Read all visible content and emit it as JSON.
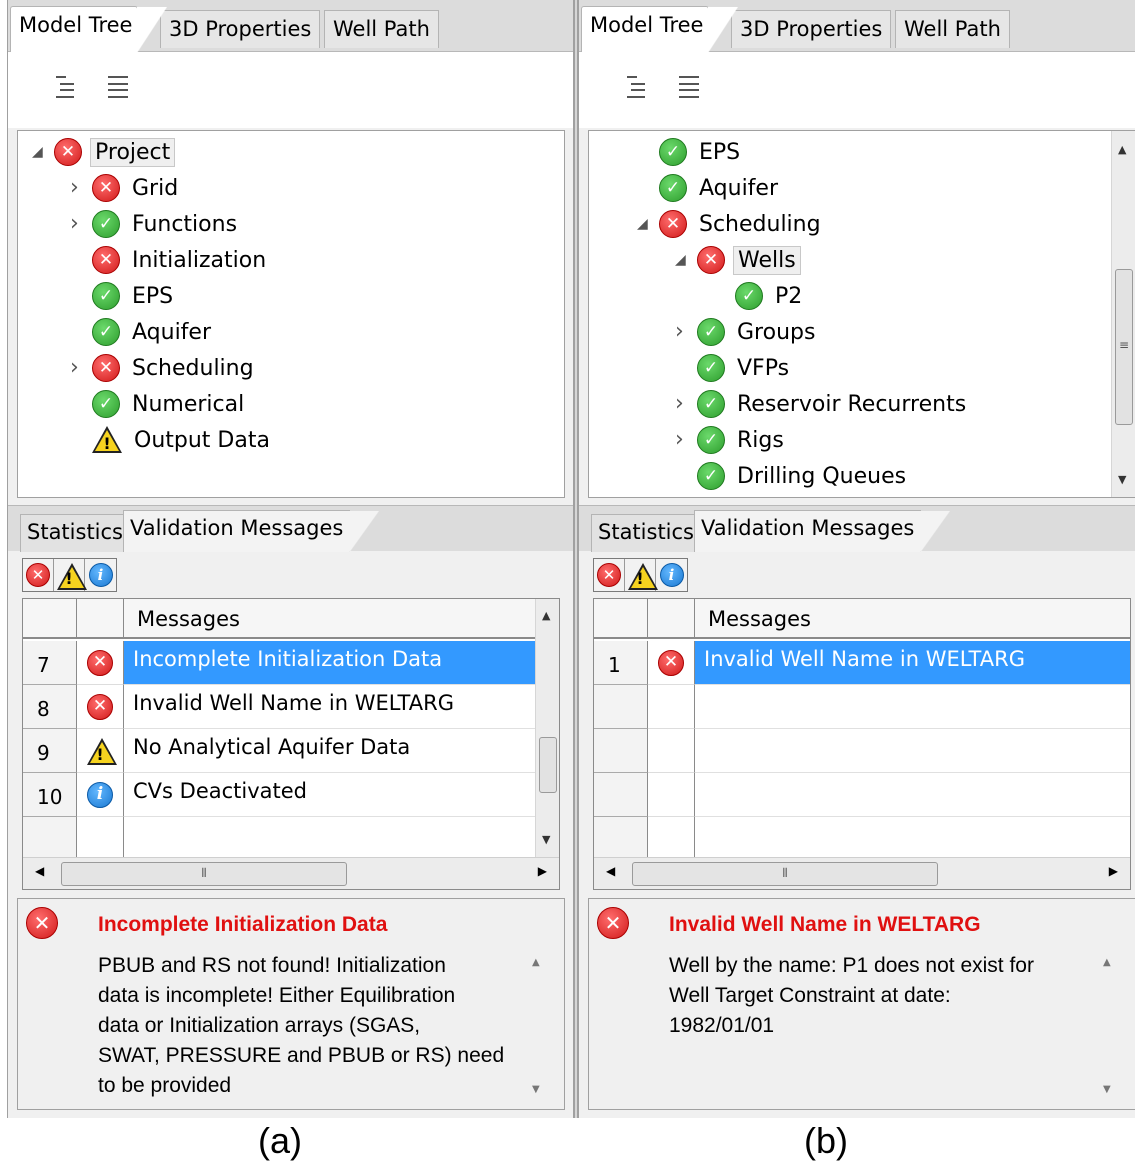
{
  "top_tabs": [
    "Model Tree",
    "3D Properties",
    "Well Path"
  ],
  "bottom_tabs": [
    "Statistics",
    "Validation Messages"
  ],
  "grid_header": "Messages",
  "panel_a": {
    "tree": [
      {
        "label": "Project",
        "status": "error",
        "twisty": "expanded"
      },
      {
        "label": "Grid",
        "status": "error",
        "twisty": "collapsed"
      },
      {
        "label": "Functions",
        "status": "ok",
        "twisty": "collapsed"
      },
      {
        "label": "Initialization",
        "status": "error"
      },
      {
        "label": "EPS",
        "status": "ok"
      },
      {
        "label": "Aquifer",
        "status": "ok"
      },
      {
        "label": "Scheduling",
        "status": "error",
        "twisty": "collapsed"
      },
      {
        "label": "Numerical",
        "status": "ok"
      },
      {
        "label": "Output Data",
        "status": "warning"
      }
    ],
    "rows": [
      {
        "num": "7",
        "type": "error",
        "message": "Incomplete Initialization Data",
        "selected": true
      },
      {
        "num": "8",
        "type": "error",
        "message": "Invalid Well Name in WELTARG"
      },
      {
        "num": "9",
        "type": "warning",
        "message": "No Analytical Aquifer Data"
      },
      {
        "num": "10",
        "type": "info",
        "message": "CVs Deactivated"
      }
    ],
    "detail_title": "Incomplete Initialization Data",
    "detail_lines": [
      "PBUB and RS not found! Initialization",
      "data is incomplete! Either Equilibration",
      "data or Initialization arrays (SGAS,",
      "SWAT, PRESSURE and PBUB or RS) need",
      "to be provided"
    ],
    "caption": "(a)"
  },
  "panel_b": {
    "tree": [
      {
        "label": "EPS",
        "status": "ok"
      },
      {
        "label": "Aquifer",
        "status": "ok"
      },
      {
        "label": "Scheduling",
        "status": "error",
        "twisty": "expanded"
      },
      {
        "label": "Wells",
        "status": "error",
        "twisty": "expanded"
      },
      {
        "label": "P2",
        "status": "ok"
      },
      {
        "label": "Groups",
        "status": "ok",
        "twisty": "collapsed"
      },
      {
        "label": "VFPs",
        "status": "ok"
      },
      {
        "label": "Reservoir Recurrents",
        "status": "ok",
        "twisty": "collapsed"
      },
      {
        "label": "Rigs",
        "status": "ok",
        "twisty": "collapsed"
      },
      {
        "label": "Drilling Queues",
        "status": "ok"
      }
    ],
    "rows": [
      {
        "num": "1",
        "type": "error",
        "message": "Invalid Well Name in WELTARG",
        "selected": true
      }
    ],
    "detail_title": "Invalid Well Name in WELTARG",
    "detail_lines": [
      "Well by the name: P1 does not exist for",
      "Well Target Constraint at date:",
      "1982/01/01"
    ],
    "caption": "(b)"
  },
  "colors": {
    "selection": "#3399ff",
    "error_title": "#e01010"
  },
  "icons": {
    "error": "error-icon",
    "ok": "check-icon",
    "warning": "warning-icon",
    "info": "info-icon"
  }
}
